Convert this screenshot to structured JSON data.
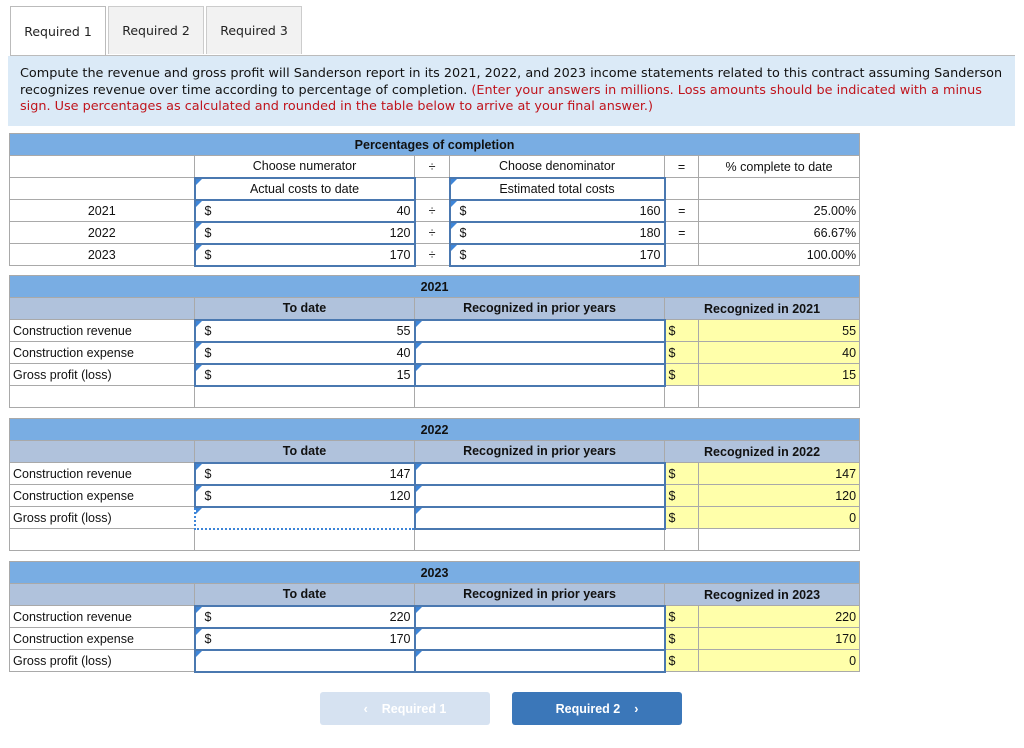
{
  "tabs": [
    {
      "label": "Required 1",
      "active": true
    },
    {
      "label": "Required 2",
      "active": false
    },
    {
      "label": "Required 3",
      "active": false
    }
  ],
  "instructions": {
    "main": "Compute the revenue and gross profit will Sanderson report in its 2021, 2022, and 2023 income statements related to this contract assuming Sanderson recognizes revenue over time according to percentage of completion.",
    "note": "(Enter your answers in millions. Loss amounts should be indicated with a minus sign. Use percentages as calculated and rounded in the table below to arrive at your final answer.)"
  },
  "completion": {
    "title": "Percentages of completion",
    "numerator_header": "Choose numerator",
    "divide_symbol": "÷",
    "denominator_header": "Choose denominator",
    "equals_symbol": "=",
    "result_header": "% complete to date",
    "numerator_value": "Actual costs to date",
    "denominator_value": "Estimated total costs",
    "currency": "$",
    "rows": [
      {
        "year": "2021",
        "numerator": "40",
        "op": "÷",
        "denominator": "160",
        "eq": "=",
        "percent": "25.00%"
      },
      {
        "year": "2022",
        "numerator": "120",
        "op": "÷",
        "denominator": "180",
        "eq": "=",
        "percent": "66.67%"
      },
      {
        "year": "2023",
        "numerator": "170",
        "op": "÷",
        "denominator": "170",
        "eq": "",
        "percent": "100.00%"
      }
    ]
  },
  "years": [
    {
      "year": "2021",
      "col_to_date": "To date",
      "col_prior": "Recognized in prior years",
      "col_current": "Recognized in 2021",
      "rows": [
        {
          "label": "Construction revenue",
          "to_date": "55",
          "prior": "",
          "current": "55"
        },
        {
          "label": "Construction expense",
          "to_date": "40",
          "prior": "",
          "current": "40"
        },
        {
          "label": "Gross profit (loss)",
          "to_date": "15",
          "prior": "",
          "current": "15"
        }
      ]
    },
    {
      "year": "2022",
      "col_to_date": "To date",
      "col_prior": "Recognized in prior years",
      "col_current": "Recognized in 2022",
      "rows": [
        {
          "label": "Construction revenue",
          "to_date": "147",
          "prior": "",
          "current": "147"
        },
        {
          "label": "Construction expense",
          "to_date": "120",
          "prior": "",
          "current": "120"
        },
        {
          "label": "Gross profit (loss)",
          "to_date": "",
          "prior": "",
          "current": "0"
        }
      ]
    },
    {
      "year": "2023",
      "col_to_date": "To date",
      "col_prior": "Recognized in prior years",
      "col_current": "Recognized in 2023",
      "rows": [
        {
          "label": "Construction revenue",
          "to_date": "220",
          "prior": "",
          "current": "220"
        },
        {
          "label": "Construction expense",
          "to_date": "170",
          "prior": "",
          "current": "170"
        },
        {
          "label": "Gross profit (loss)",
          "to_date": "",
          "prior": "",
          "current": "0"
        }
      ]
    }
  ],
  "nav": {
    "prev_label": "Required 1",
    "prev_icon": "chevron-left-icon",
    "next_label": "Required 2",
    "next_icon": "chevron-right-icon"
  }
}
